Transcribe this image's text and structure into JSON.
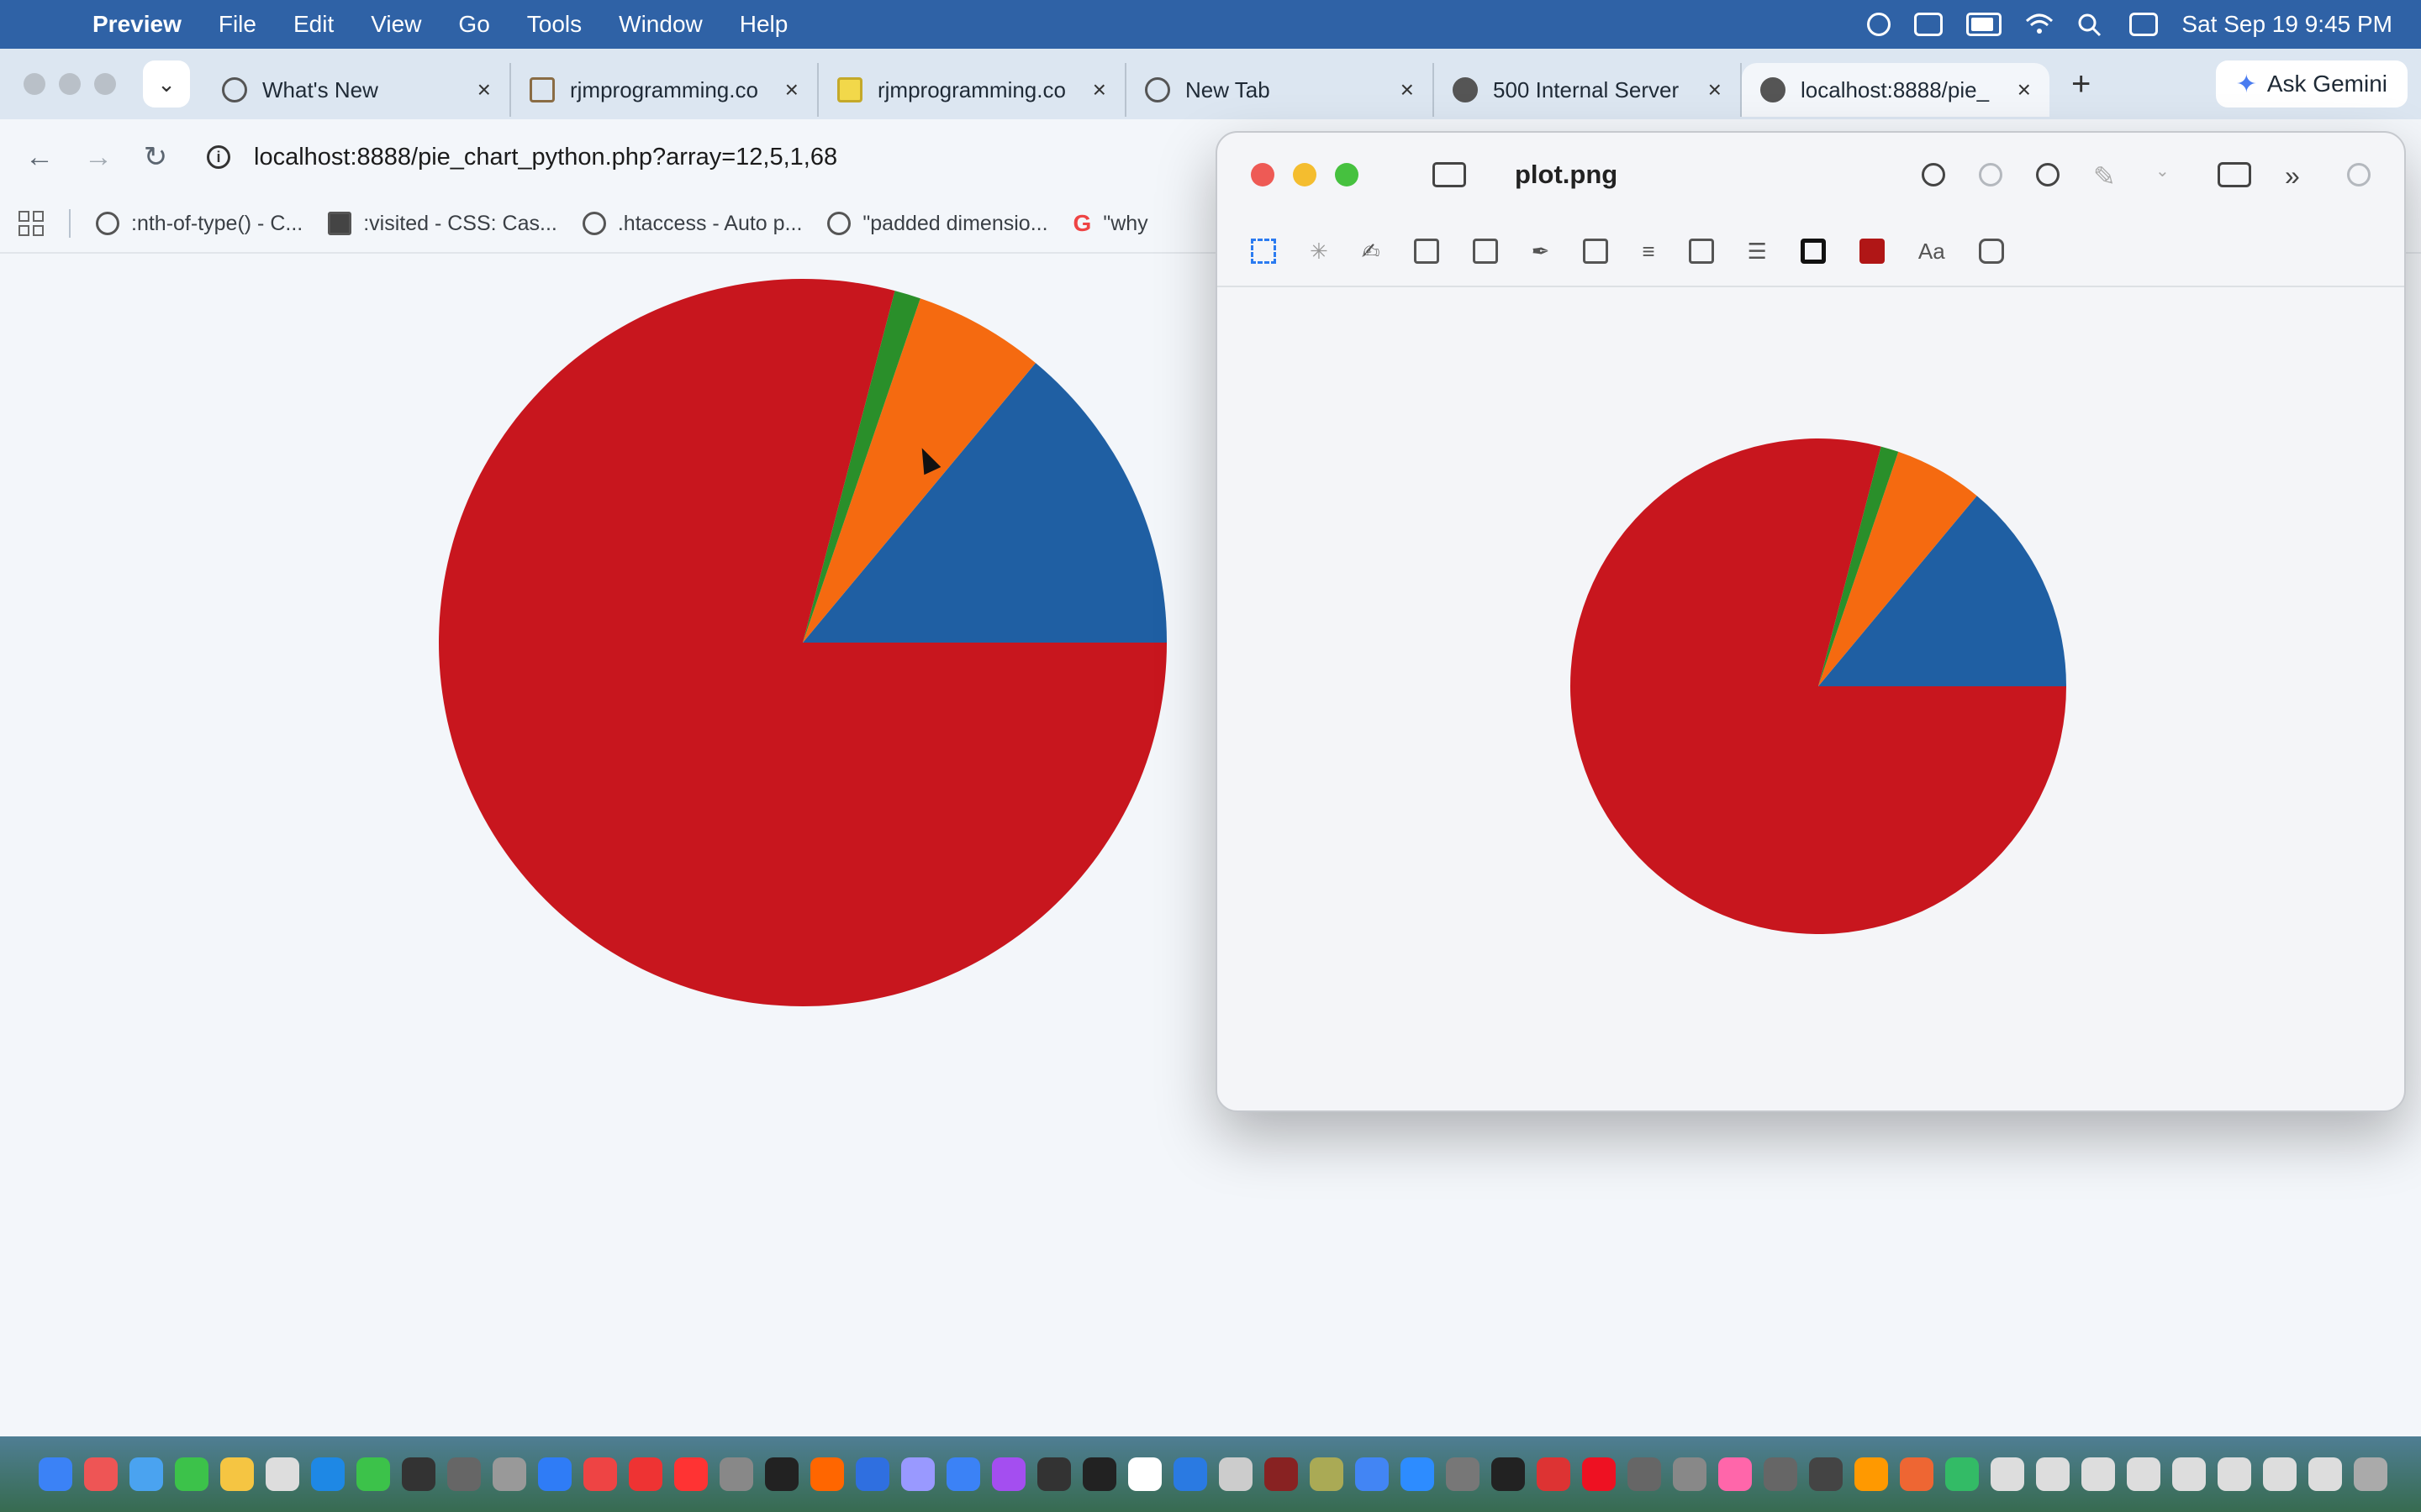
{
  "menubar": {
    "app_name": "Preview",
    "menus": [
      "File",
      "Edit",
      "View",
      "Go",
      "Tools",
      "Window",
      "Help"
    ],
    "clock": "Sat Sep 19  9:45 PM"
  },
  "browser": {
    "tabs": [
      {
        "title": "What's New",
        "icon": "chrome-icon"
      },
      {
        "title": "rjmprogramming.co",
        "icon": "rjm-icon"
      },
      {
        "title": "rjmprogramming.co",
        "icon": "checkmark-icon"
      },
      {
        "title": "New Tab",
        "icon": "chrome-icon"
      },
      {
        "title": "500 Internal Server",
        "icon": "github-icon"
      },
      {
        "title": "localhost:8888/pie_",
        "icon": "github-icon",
        "active": true
      }
    ],
    "ask_gemini": "Ask Gemini",
    "url": "localhost:8888/pie_chart_python.php?array=12,5,1,68",
    "bookmarks": [
      ":nth-of-type() - C...",
      ":visited - CSS: Cas...",
      ".htaccess - Auto p...",
      "\"padded dimensio...",
      "\"why"
    ]
  },
  "preview": {
    "title": "plot.png"
  },
  "chart_data": {
    "type": "pie",
    "values": [
      12,
      5,
      1,
      68
    ],
    "colors": [
      "#1f5fa3",
      "#f56a10",
      "#2a8f2a",
      "#c8161e"
    ],
    "start_angle_deg": 0,
    "direction": "counterclockwise"
  }
}
